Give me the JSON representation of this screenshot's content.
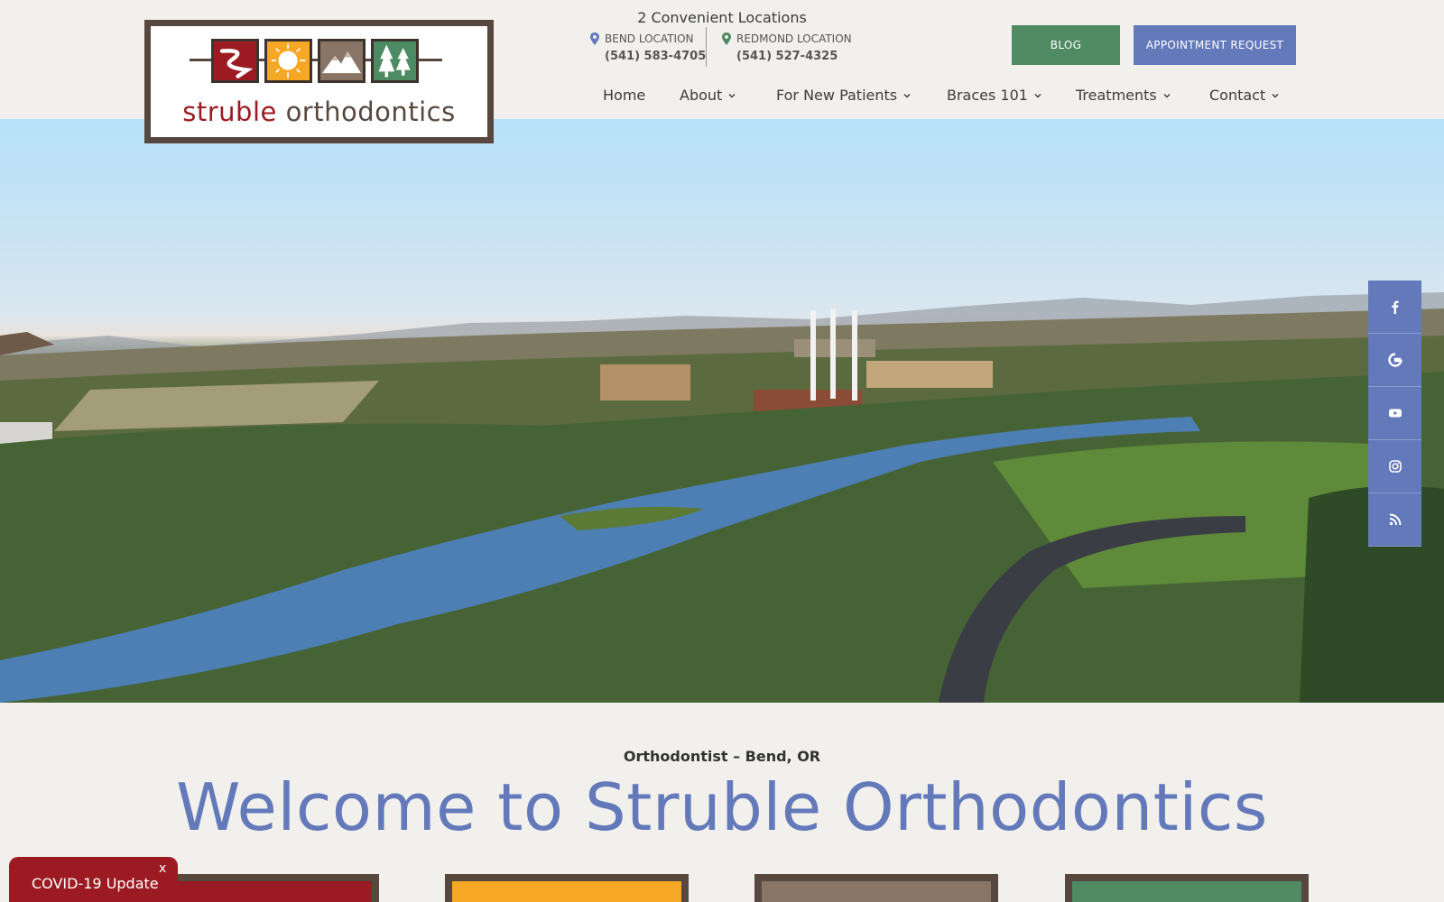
{
  "logo": {
    "word1": "struble",
    "word2": "orthodontics"
  },
  "locations": {
    "title": "2 Convenient Locations",
    "items": [
      {
        "label": "BEND LOCATION",
        "phone": "(541) 583-4705"
      },
      {
        "label": "REDMOND LOCATION",
        "phone": "(541) 527-4325"
      }
    ]
  },
  "buttons": {
    "blog": "BLOG",
    "appointment": "APPOINTMENT REQUEST"
  },
  "nav": {
    "items": [
      {
        "label": "Home",
        "dropdown": false
      },
      {
        "label": "About",
        "dropdown": true
      },
      {
        "label": "For New Patients",
        "dropdown": true
      },
      {
        "label": "Braces 101",
        "dropdown": true
      },
      {
        "label": "Treatments",
        "dropdown": true
      },
      {
        "label": "Contact",
        "dropdown": true
      }
    ]
  },
  "social": {
    "icons": [
      "facebook-icon",
      "google-icon",
      "youtube-icon",
      "instagram-icon",
      "rss-icon"
    ]
  },
  "welcome": {
    "subtitle": "Orthodontist – Bend, OR",
    "title": "Welcome to Struble Orthodontics"
  },
  "covid": {
    "label": "COVID-19 Update",
    "close": "x"
  },
  "colors": {
    "brand_red": "#9c1b22",
    "brand_orange": "#f6a724",
    "brand_brown": "#56483f",
    "brand_taupe": "#897565",
    "brand_green": "#4f8a63",
    "brand_blue": "#6379ba"
  }
}
